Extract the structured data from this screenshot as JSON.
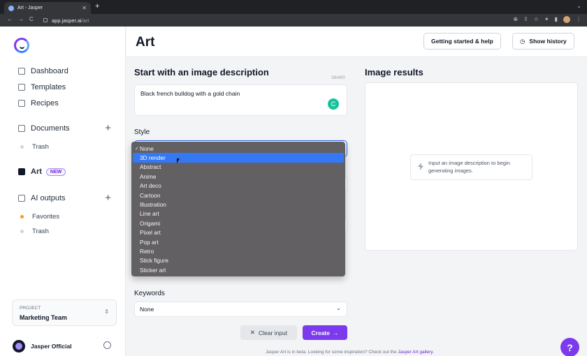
{
  "browser": {
    "tab_title": "Art - Jasper",
    "url_host": "app.jasper.ai",
    "url_path": "/art"
  },
  "sidebar": {
    "main_nav": [
      {
        "label": "Dashboard",
        "icon": "home-icon"
      },
      {
        "label": "Templates",
        "icon": "grid-icon"
      },
      {
        "label": "Recipes",
        "icon": "recipe-icon"
      }
    ],
    "documents_label": "Documents",
    "documents_trash": "Trash",
    "art_label": "Art",
    "art_badge": "NEW",
    "ai_outputs_label": "AI outputs",
    "favorites_label": "Favorites",
    "ai_trash": "Trash",
    "project_label": "PROJECT",
    "project_value": "Marketing Team",
    "user_name": "Jasper Official"
  },
  "header": {
    "title": "Art",
    "help_button": "Getting started & help",
    "history_button": "Show history"
  },
  "form": {
    "description_title": "Start with an image description",
    "char_counter": "38/400",
    "description_value": "Black french bulldog with a gold chain",
    "style_label": "Style",
    "style_options": [
      "None",
      "3D render",
      "Abstract",
      "Anime",
      "Art deco",
      "Cartoon",
      "Illustration",
      "Line art",
      "Origami",
      "Pixel art",
      "Pop art",
      "Retro",
      "Stick figure",
      "Sticker art"
    ],
    "style_selected": "None",
    "style_highlighted": "3D render",
    "keywords_label": "Keywords",
    "keywords_value": "None",
    "clear_button": "Clear input",
    "create_button": "Create"
  },
  "results": {
    "title": "Image results",
    "empty_hint": "Input an image description to begin generating images."
  },
  "footer": {
    "note": "Jasper Art is in beta. Looking for some inspiration? Check out the",
    "link": "Jasper Art gallery."
  },
  "colors": {
    "accent": "#7c3aed",
    "highlight": "#3478f6"
  }
}
